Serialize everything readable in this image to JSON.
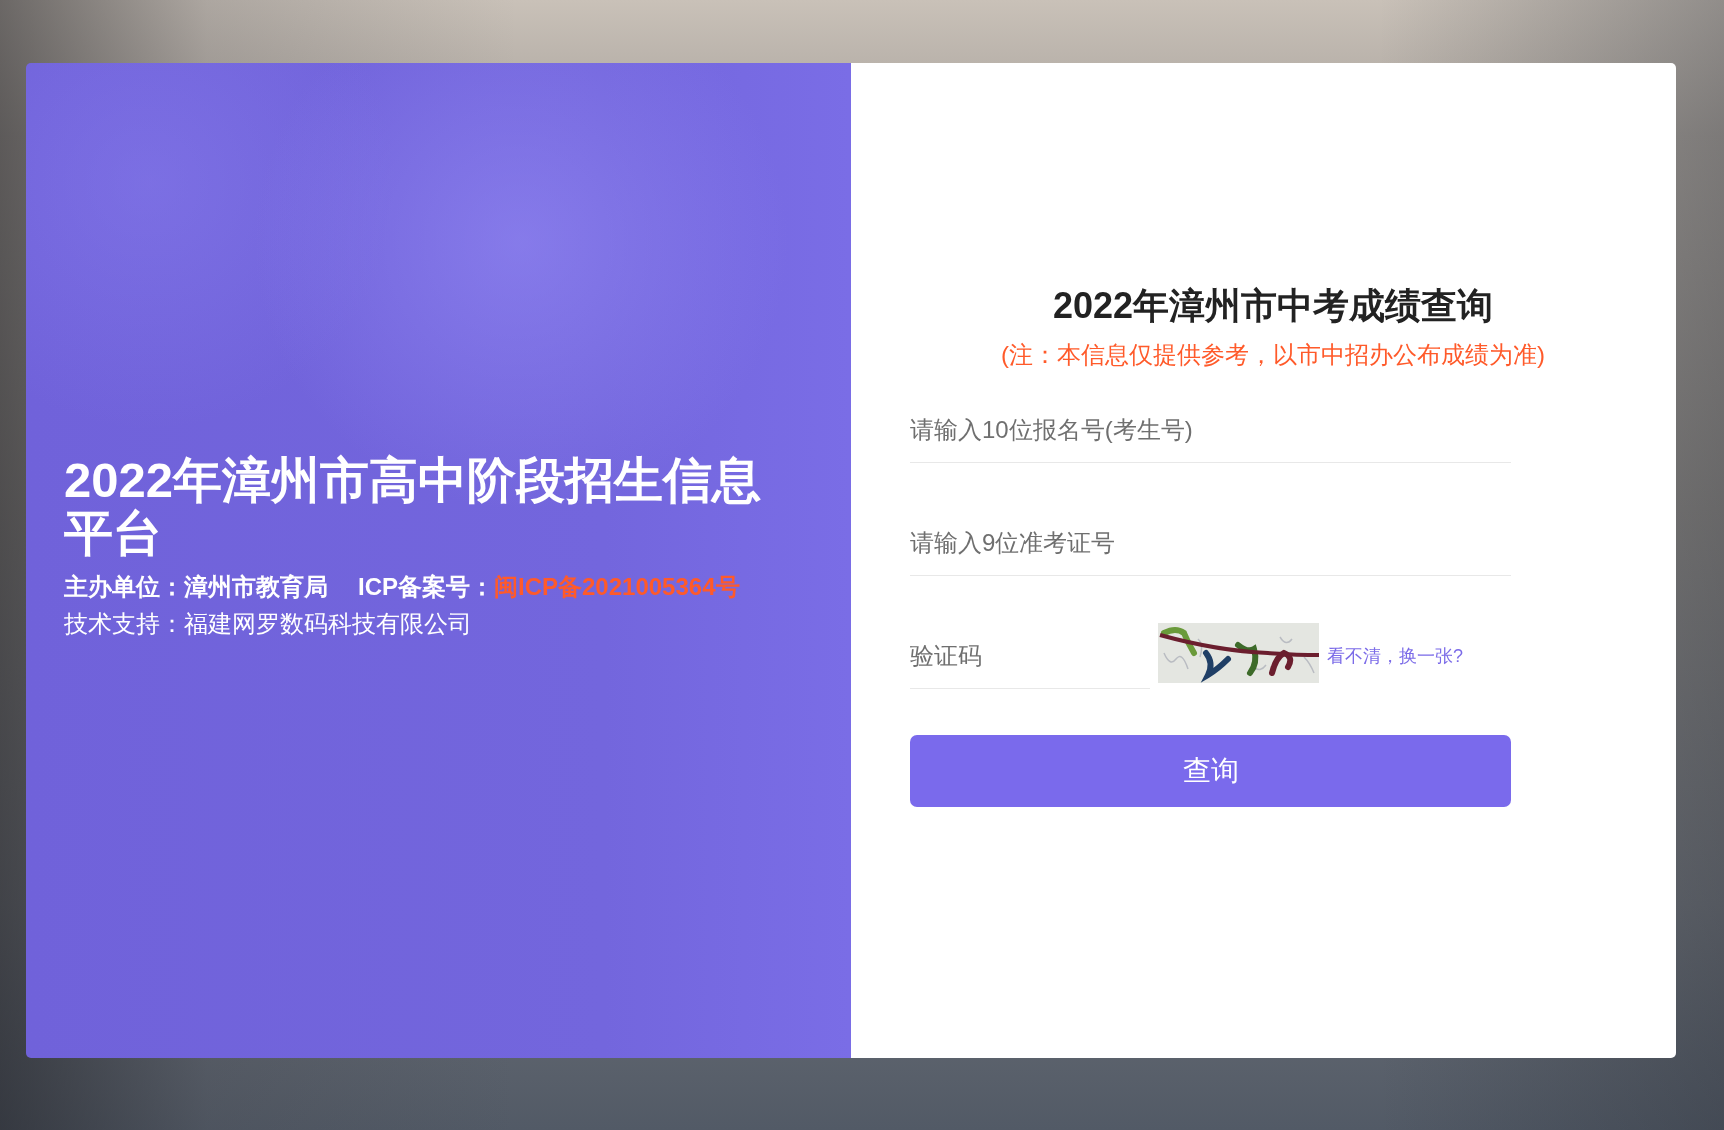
{
  "banner": {
    "title": "2022年漳州市高中阶段招生信息平台",
    "sponsor": "主办单位：漳州市教育局",
    "icp_label": "ICP备案号：",
    "icp_number": "闽ICP备2021005364号",
    "support": "技术支持：福建网罗数码科技有限公司"
  },
  "query_form": {
    "title": "2022年漳州市中考成绩查询",
    "note": "(注：本信息仅提供参考，以市中招办公布成绩为准)",
    "fields": [
      {
        "kind": "text",
        "placeholder": "请输入10位报名号(考生号)"
      },
      {
        "kind": "text",
        "placeholder": "请输入9位准考证号"
      },
      {
        "kind": "captcha",
        "placeholder": "验证码",
        "refresh_link": "看不清，换一张?"
      }
    ],
    "submit": "查询"
  }
}
